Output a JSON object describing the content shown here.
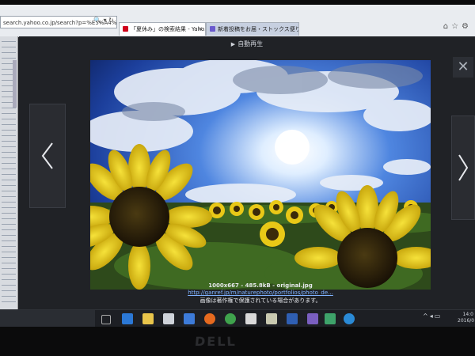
{
  "browser": {
    "address": "search.yahoo.co.jp/search?p=%E5%A4%8F%E4%BC%91",
    "tabs": [
      {
        "label": "「夏休み」の検索結果 - Yaho..."
      },
      {
        "label": "新着投稿をお届・ストックス便り..."
      }
    ]
  },
  "page": {
    "search_label": "検索"
  },
  "viewer": {
    "slideshow_label": "自動再生",
    "image": {
      "dimensions_line": "1000x667 - 485.8kB - original.jpg",
      "link": "http://ganref.jp/m/naturephoto/portfolios/photo_de...",
      "note": "画像は著作権で保護されている場合があります。"
    }
  },
  "taskbar": {
    "clock_time": "14:0",
    "clock_date": "2016/0"
  },
  "bezel": {
    "brand": "DELL"
  }
}
